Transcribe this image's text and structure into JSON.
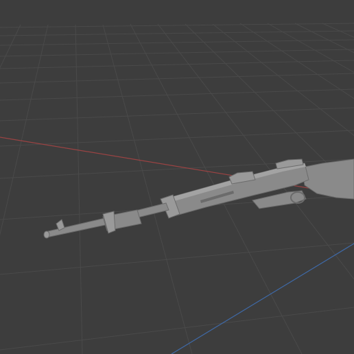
{
  "viewport": {
    "background_color": "#3d3d3d",
    "grid_color": "#4a4a4a",
    "x_axis_color": "#9b4343",
    "y_axis_color": "#3f6aa8"
  },
  "model": {
    "name_icon": "rifle-model",
    "body_color": "#8a8a8a",
    "light_color": "#a3a3a3",
    "dark_color": "#6b6b6b"
  }
}
